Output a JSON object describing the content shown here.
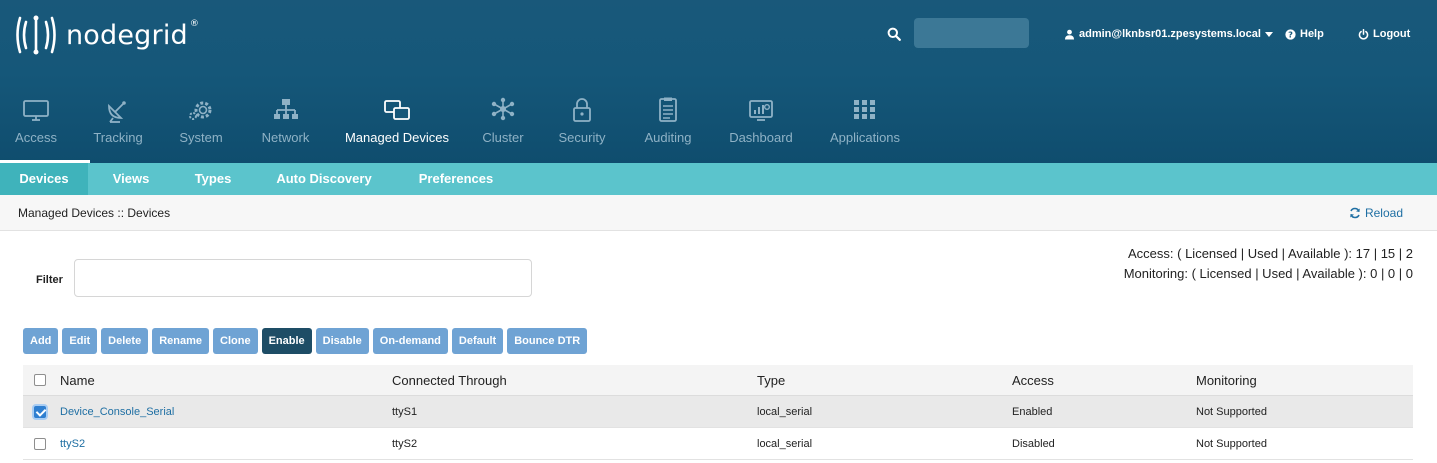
{
  "header": {
    "logo_text": "nodegrid",
    "logo_reg": "®",
    "search_placeholder": "",
    "user": "admin@lknbsr01.zpesystems.local",
    "help": "Help",
    "logout": "Logout",
    "colors": {
      "header_bg": "#155779",
      "subnav_bg": "#5bc4cc",
      "button": "#6fa3d4",
      "button_active": "#1e4d66"
    }
  },
  "nav": {
    "items": [
      {
        "label": "Access",
        "icon": "monitor-icon"
      },
      {
        "label": "Tracking",
        "icon": "satellite-dish-icon"
      },
      {
        "label": "System",
        "icon": "gears-icon"
      },
      {
        "label": "Network",
        "icon": "network-icon"
      },
      {
        "label": "Managed Devices",
        "icon": "managed-devices-icon",
        "active": true
      },
      {
        "label": "Cluster",
        "icon": "cluster-icon"
      },
      {
        "label": "Security",
        "icon": "lock-icon"
      },
      {
        "label": "Auditing",
        "icon": "clipboard-icon"
      },
      {
        "label": "Dashboard",
        "icon": "dashboard-icon"
      },
      {
        "label": "Applications",
        "icon": "grid-icon"
      }
    ]
  },
  "subnav": {
    "items": [
      {
        "label": "Devices",
        "active": true
      },
      {
        "label": "Views"
      },
      {
        "label": "Types"
      },
      {
        "label": "Auto Discovery"
      },
      {
        "label": "Preferences"
      }
    ]
  },
  "breadcrumb": "Managed Devices :: Devices",
  "reload": "Reload",
  "filter": {
    "label": "Filter",
    "value": ""
  },
  "license": {
    "access": "Access: ( Licensed | Used | Available ): 17 | 15 | 2",
    "monitoring": "Monitoring: ( Licensed | Used | Available ): 0 | 0 | 0"
  },
  "toolbar": {
    "buttons": [
      "Add",
      "Edit",
      "Delete",
      "Rename",
      "Clone",
      "Enable",
      "Disable",
      "On-demand",
      "Default",
      "Bounce DTR"
    ]
  },
  "table": {
    "headers": {
      "name": "Name",
      "connected": "Connected Through",
      "type": "Type",
      "access": "Access",
      "monitoring": "Monitoring"
    },
    "rows": [
      {
        "name": "Device_Console_Serial",
        "connected": "ttyS1",
        "type": "local_serial",
        "access": "Enabled",
        "monitoring": "Not Supported",
        "checked": true
      },
      {
        "name": "ttyS2",
        "connected": "ttyS2",
        "type": "local_serial",
        "access": "Disabled",
        "monitoring": "Not Supported",
        "checked": false
      }
    ]
  }
}
